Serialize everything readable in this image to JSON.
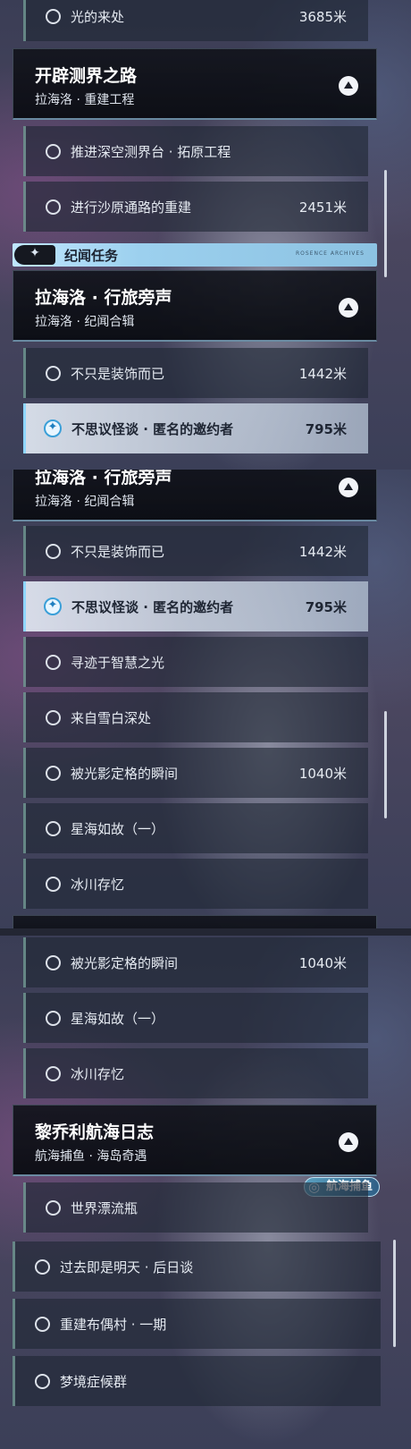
{
  "panel1": {
    "item_top": {
      "label": "光的来处",
      "distance": "3685米"
    },
    "header1": {
      "title": "开辟测界之路",
      "subtitle": "拉海洛 · 重建工程"
    },
    "items1": [
      {
        "label": "推进深空测界台 · 拓原工程",
        "distance": ""
      },
      {
        "label": "进行沙原通路的重建",
        "distance": "2451米"
      }
    ],
    "banner": {
      "title": "纪闻任务",
      "sub": "ROSENCE ARCHIVES"
    },
    "header2": {
      "title": "拉海洛 · 行旅旁声",
      "subtitle": "拉海洛 · 纪闻合辑"
    },
    "items2": [
      {
        "label": "不只是装饰而已",
        "distance": "1442米"
      },
      {
        "label": "不思议怪谈 · 匿名的邀约者",
        "distance": "795米"
      }
    ]
  },
  "panel2": {
    "header": {
      "title": "拉海洛 · 行旅旁声",
      "subtitle": "拉海洛 · 纪闻合辑"
    },
    "items": [
      {
        "label": "不只是装饰而已",
        "distance": "1442米"
      },
      {
        "label": "不思议怪谈 · 匿名的邀约者",
        "distance": "795米"
      },
      {
        "label": "寻迹于智慧之光",
        "distance": ""
      },
      {
        "label": "来自雪白深处",
        "distance": ""
      },
      {
        "label": "被光影定格的瞬间",
        "distance": "1040米"
      },
      {
        "label": "星海如故（一）",
        "distance": ""
      },
      {
        "label": "冰川存忆",
        "distance": ""
      }
    ]
  },
  "panel3": {
    "items_a": [
      {
        "label": "被光影定格的瞬间",
        "distance": "1040米"
      },
      {
        "label": "星海如故（一）",
        "distance": ""
      },
      {
        "label": "冰川存忆",
        "distance": ""
      }
    ],
    "header": {
      "title": "黎乔利航海日志",
      "subtitle": "航海捕鱼 · 海岛奇遇"
    },
    "badge": "航海捕鱼",
    "items_b": [
      {
        "label": "世界漂流瓶",
        "distance": ""
      },
      {
        "label": "过去即是明天 · 后日谈",
        "distance": ""
      },
      {
        "label": "重建布偶村 · 一期",
        "distance": ""
      },
      {
        "label": "梦境症候群",
        "distance": ""
      }
    ]
  }
}
